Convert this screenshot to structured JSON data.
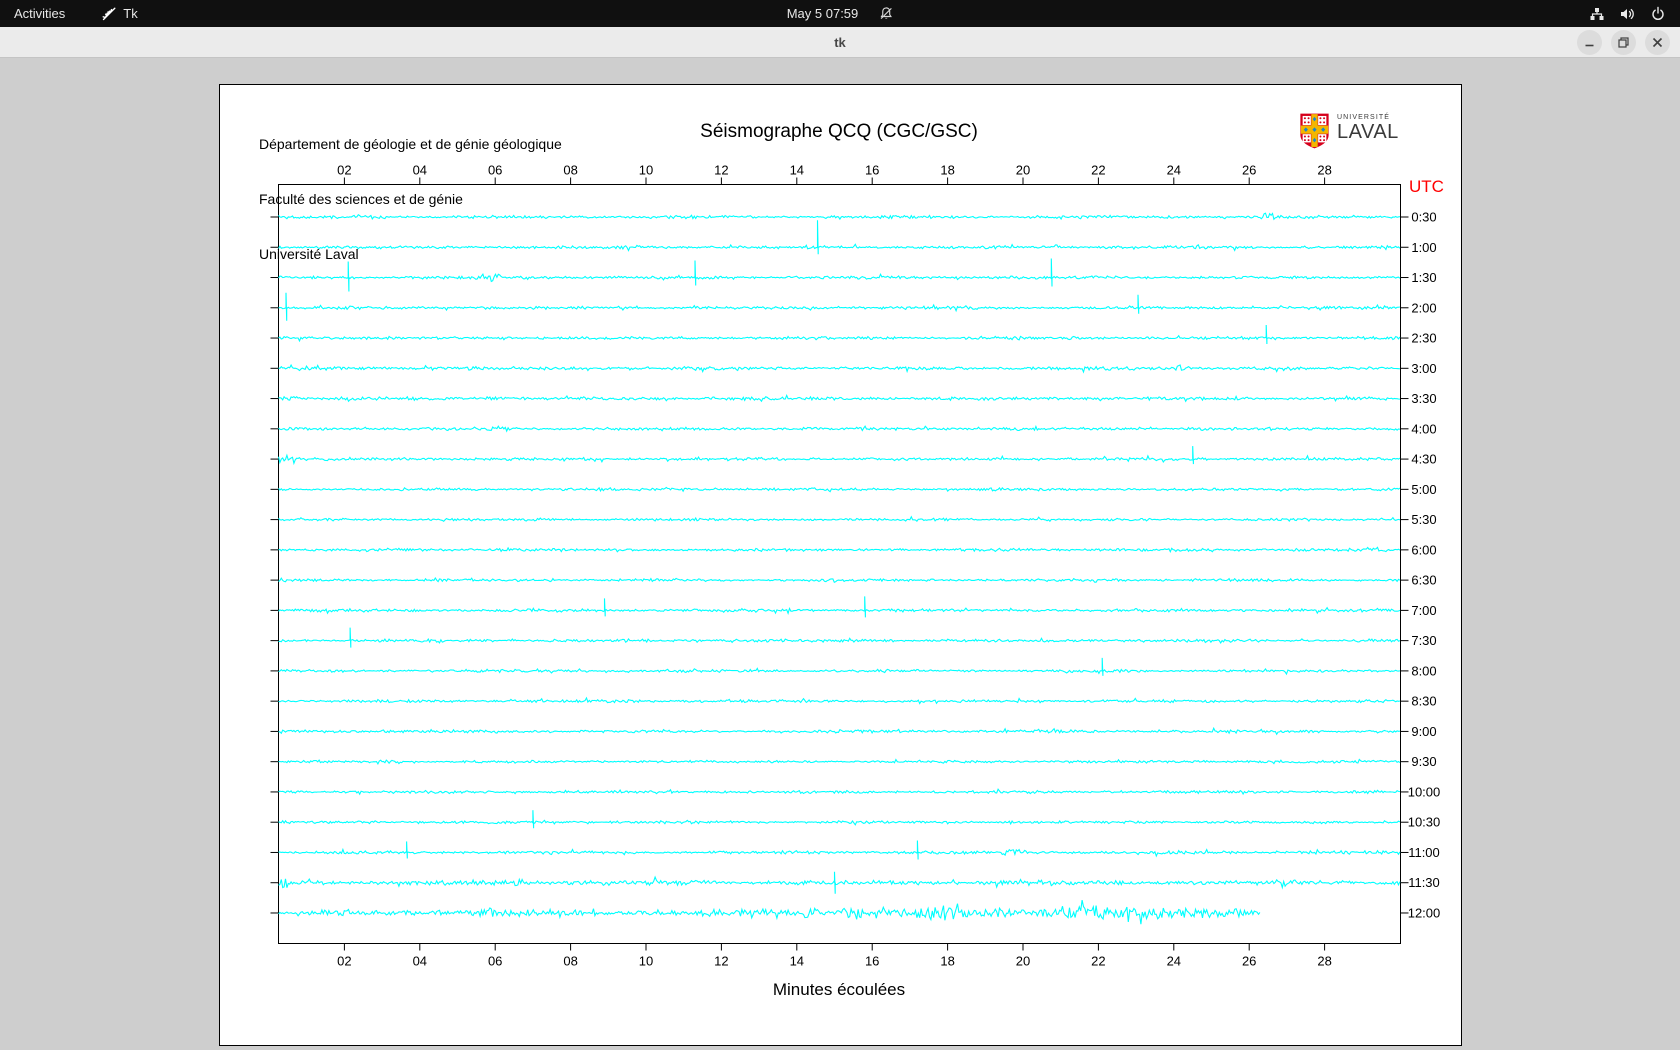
{
  "topbar": {
    "activities_label": "Activities",
    "app_name": "Tk",
    "clock": "May 5 07:59"
  },
  "titlebar": {
    "title": "tk"
  },
  "canvas": {
    "header_lines": [
      "Département de géologie et de génie géologique",
      "Faculté des sciences et de génie",
      "Université Laval"
    ],
    "title": "Séismographe QCQ (CGC/GSC)",
    "logo": {
      "line1": "UNIVERSITÉ",
      "line2": "LAVAL"
    },
    "utc_label": "UTC",
    "xlabel": "Minutes écoulées"
  },
  "chart_data": {
    "type": "line",
    "title": "Séismographe QCQ (CGC/GSC)",
    "xlabel": "Minutes écoulées",
    "ylabel_right": "UTC",
    "x_range_minutes": [
      0,
      30
    ],
    "x_ticks": [
      "02",
      "04",
      "06",
      "08",
      "10",
      "12",
      "14",
      "16",
      "18",
      "20",
      "22",
      "24",
      "26",
      "28"
    ],
    "grid": false,
    "trace_color": "#00ffff",
    "utc_color": "#ff0000",
    "rows": [
      {
        "label": "0:30",
        "noise": 1.0,
        "bursts": [
          {
            "m": 3.0,
            "w": 0.8,
            "f": 1.8
          },
          {
            "m": 26.5,
            "w": 0.35,
            "f": 3.2
          }
        ]
      },
      {
        "label": "1:00",
        "noise": 1.0,
        "spikes": [
          {
            "m": 14.55,
            "up": 27,
            "dn": 7
          }
        ],
        "bursts": [
          {
            "m": 9.6,
            "w": 0.3,
            "f": 2.6
          }
        ]
      },
      {
        "label": "1:30",
        "noise": 1.0,
        "spikes": [
          {
            "m": 2.1,
            "up": 16,
            "dn": 14
          },
          {
            "m": 11.3,
            "up": 17,
            "dn": 8
          },
          {
            "m": 20.75,
            "up": 19,
            "dn": 9
          }
        ],
        "bursts": [
          {
            "m": 5.95,
            "w": 0.3,
            "f": 2.8
          }
        ]
      },
      {
        "label": "2:00",
        "noise": 1.0,
        "spikes": [
          {
            "m": 0.45,
            "up": 15,
            "dn": 13
          },
          {
            "m": 23.05,
            "up": 13,
            "dn": 6
          }
        ]
      },
      {
        "label": "2:30",
        "noise": 1.0,
        "spikes": [
          {
            "m": 26.45,
            "up": 13,
            "dn": 6
          }
        ]
      },
      {
        "label": "3:00",
        "noise": 1.1,
        "bursts": [
          {
            "m": 1.0,
            "w": 0.8,
            "f": 1.7
          },
          {
            "m": 24.2,
            "w": 0.2,
            "f": 3.4
          }
        ]
      },
      {
        "label": "3:30",
        "noise": 1.1,
        "bursts": [
          {
            "m": 0.55,
            "w": 0.4,
            "f": 2.6
          },
          {
            "m": 6.0,
            "w": 0.4,
            "f": 2.4
          }
        ]
      },
      {
        "label": "4:00",
        "noise": 1.0,
        "bursts": [
          {
            "m": 6.1,
            "w": 0.35,
            "f": 2.6
          }
        ]
      },
      {
        "label": "4:30",
        "noise": 1.0,
        "spikes": [
          {
            "m": 24.5,
            "up": 13,
            "dn": 5
          }
        ],
        "bursts": [
          {
            "m": 0.3,
            "w": 0.4,
            "f": 3.0
          }
        ]
      },
      {
        "label": "5:00",
        "noise": 0.9
      },
      {
        "label": "5:30",
        "noise": 0.9
      },
      {
        "label": "6:00",
        "noise": 1.0,
        "bursts": [
          {
            "m": 6.2,
            "w": 0.5,
            "f": 1.8
          }
        ]
      },
      {
        "label": "6:30",
        "noise": 0.9
      },
      {
        "label": "7:00",
        "noise": 1.0,
        "spikes": [
          {
            "m": 8.9,
            "up": 12,
            "dn": 6
          },
          {
            "m": 15.8,
            "up": 14,
            "dn": 7
          }
        ]
      },
      {
        "label": "7:30",
        "noise": 1.0,
        "spikes": [
          {
            "m": 2.15,
            "up": 13,
            "dn": 7
          }
        ]
      },
      {
        "label": "8:00",
        "noise": 0.9,
        "spikes": [
          {
            "m": 22.1,
            "up": 13,
            "dn": 5
          }
        ]
      },
      {
        "label": "8:30",
        "noise": 0.9
      },
      {
        "label": "9:00",
        "noise": 1.0,
        "bursts": [
          {
            "m": 25.5,
            "w": 0.4,
            "f": 1.8
          }
        ]
      },
      {
        "label": "9:30",
        "noise": 0.9,
        "bursts": [
          {
            "m": 3.3,
            "w": 0.3,
            "f": 2.2
          }
        ]
      },
      {
        "label": "10:00",
        "noise": 0.9
      },
      {
        "label": "10:30",
        "noise": 0.9,
        "spikes": [
          {
            "m": 7.0,
            "up": 12,
            "dn": 6
          }
        ]
      },
      {
        "label": "11:00",
        "noise": 1.0,
        "spikes": [
          {
            "m": 3.65,
            "up": 11,
            "dn": 6
          },
          {
            "m": 17.2,
            "up": 12,
            "dn": 7
          }
        ],
        "bursts": [
          {
            "m": 19.75,
            "w": 0.5,
            "f": 2.6
          }
        ]
      },
      {
        "label": "11:30",
        "noise": 1.6,
        "spikes": [
          {
            "m": 15.0,
            "up": 11,
            "dn": 11
          }
        ],
        "bursts": [
          {
            "m": 0.35,
            "w": 0.4,
            "f": 2.4
          },
          {
            "m": 6.6,
            "w": 0.3,
            "f": 2.4
          },
          {
            "m": 26.9,
            "w": 0.4,
            "f": 2.2
          }
        ]
      },
      {
        "label": "12:00",
        "noise": 2.0,
        "end": 26.3,
        "hi": {
          "from": 14.2,
          "to": 25.9,
          "f": 2.2
        },
        "bursts": [
          {
            "m": 5.8,
            "w": 0.4,
            "f": 1.8
          },
          {
            "m": 10.4,
            "w": 0.3,
            "f": 1.6
          }
        ]
      }
    ]
  }
}
